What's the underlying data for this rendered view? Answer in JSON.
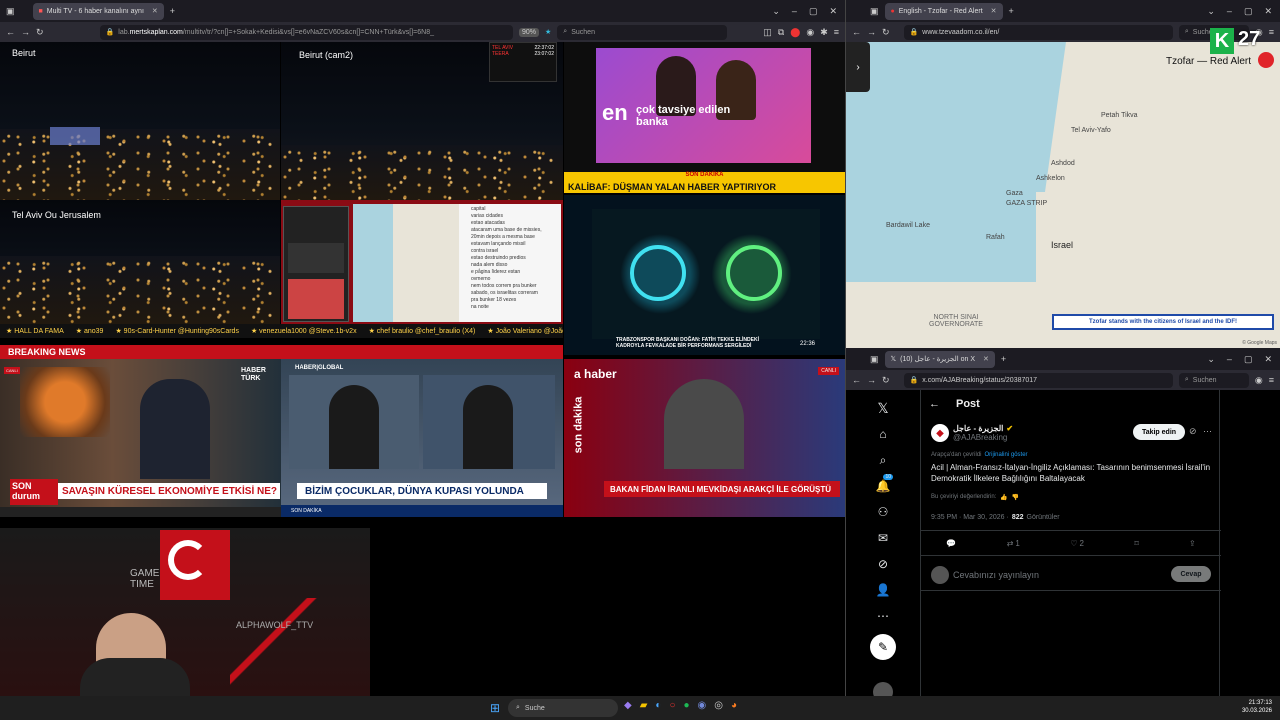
{
  "left_browser": {
    "tab_title": "Multi TV - 6 haber kanalını aynı",
    "url_prefix": "lab.",
    "url_domain": "mertskaplan.com",
    "url_rest": "/multitv/tr/?cn[]=+Sokak+Kedisi&vs[]=e6vNaZCV60s&cn[]=CNN+Türk&vs[]=6N8_",
    "zoom": "90%",
    "search_placeholder": "Suchen"
  },
  "tiles": {
    "beirut": "Beirut",
    "beirut_cam2": "Beirut (cam2)",
    "tel_aviv": "Tel Aviv Ou Jerusalem",
    "alert_tel_aviv": "TEL AVIV",
    "alert_tel_aviv_time": "22:37:02",
    "alert_teera": "TEERA",
    "alert_teera_time": "23:07:02",
    "ad_logo": "en",
    "ad_text": "çok tavsiye edilen banka",
    "son_dakika": "SON DAKİKA",
    "kalibaf": "KALİBAF: DÜŞMAN YALAN HABER YAPTIRIYOR",
    "trabzon": "TRABZONSPOR BAŞKANI DOĞAN: FATİH TEKKE ELİNDEKİ KADROYLA FEVKALADE BİR PERFORMANS SERGİLEDİ",
    "time_tile": "22:36",
    "breaking_news": "BREAKING NEWS",
    "haber_turk": "HABER TÜRK",
    "son_durum": "SON durum",
    "savasin": "SAVAŞIN KÜRESEL EKONOMİYE ETKİSİ NE?",
    "haber_global": "HABER|GLOBAL",
    "cocuklar": "BİZİM ÇOCUKLAR, DÜNYA KUPASI YOLUNDA",
    "son_dakika_2": "SON DAKİKA",
    "a_haber": "a haber",
    "son_dakika_vertical": "son dakika",
    "fidan": "BAKAN FİDAN İRANLI MEVKİDAŞI ARAKÇİ İLE GÖRÜŞTÜ",
    "canli": "CANLI"
  },
  "ticker": {
    "items": [
      "HALL DA FAMA",
      "ano39",
      "90s-Card-Hunter @Hunting90sCards",
      "venezuela1000 @Steve.1b-v2x",
      "chef braulio @chef_braulio (X4)",
      "João Valeriano @JoãoVale"
    ]
  },
  "chat_lines": [
    "capital",
    "varias cidades",
    "estao atacadas",
    "atacaram uma base de missies,",
    "20min depois a mesma base",
    "estavam lançando missil",
    "contra israel",
    "estao destruindo predios",
    "nada alem disso",
    "e pågina lìderez estan",
    "ovmerno",
    "nem todos correm pra bunker",
    "sabado, os israelitas correram",
    "pra bunker 18 vezes",
    "na noite"
  ],
  "right_top": {
    "tab_title": "English - Tzofar - Red Alert",
    "url": "www.tzevaadom.co.il/en/",
    "search_placeholder": "Suchen",
    "badge_number": "27",
    "brand": "Tzofar — Red Alert",
    "map_labels": [
      "Tel Aviv-Yafo",
      "Ashdod",
      "Ashkelon",
      "GAZA STRIP",
      "Gaza",
      "Israel",
      "NORTH SINAI GOVERNORATE",
      "Bardawil Lake",
      "Rafah",
      "Petah Tikva"
    ],
    "banner": "Tzofar stands with the citizens of Israel and the IDF!",
    "map_credit": "© Google Maps"
  },
  "right_bottom": {
    "tab_title": "(10) الجزيرة - عاجل on X",
    "url": "x.com/AJABreaking/status/20387017",
    "search_placeholder": "Suchen",
    "post_header": "Post",
    "account_name": "الجزيرة - عاجل",
    "account_handle": "@AJABreaking",
    "follow_button": "Takip edin",
    "translated_note": "Arapça'dan çevrildi",
    "show_original": "Orijinalini göster",
    "post_text": "Acil | Alman-Fransız-İtalyan-İngiliz Açıklaması: Tasarının benimsenmesi İsrail'in Demokratik İlkelere Bağlılığını Baltalayacak",
    "rate_translation": "Bu çeviriyi değerlendirin:",
    "timestamp": "9:35 PM · Mar 30, 2026 ·",
    "views_count": "822",
    "views_label": "Görüntüler",
    "reposts": "1",
    "likes": "2",
    "reply_placeholder": "Cevabınızı yayınlayın",
    "reply_button": "Cevap",
    "nav_badge": "10"
  },
  "webcam": {
    "sign": "GAME TIME",
    "name": "ALPHAWOLF_TTV"
  },
  "taskbar": {
    "search": "Suche",
    "time": "21:37:13",
    "date": "30.03.2026"
  },
  "colors": {
    "breaking_red": "#c4101a",
    "ticker_yellow": "#ffd24a",
    "x_blue": "#1d9bf0",
    "alert_red": "#e0242a"
  }
}
